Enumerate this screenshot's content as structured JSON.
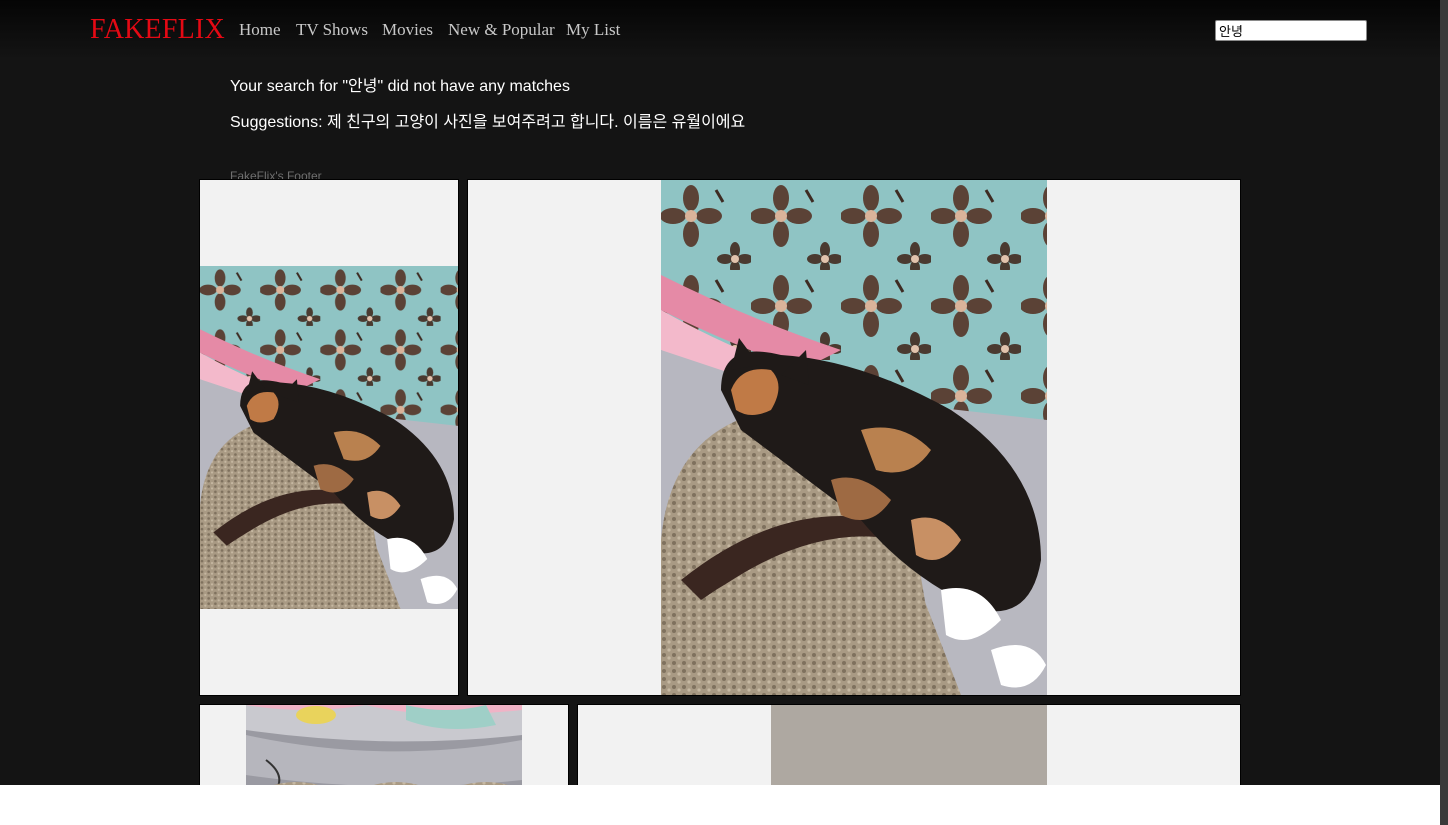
{
  "header": {
    "logo": "FAKEFLIX",
    "nav": [
      {
        "label": "Home"
      },
      {
        "label": "TV Shows"
      },
      {
        "label": "Movies"
      },
      {
        "label": "New & Popular"
      },
      {
        "label": "My List"
      }
    ],
    "search": {
      "value": "안녕"
    }
  },
  "results": {
    "no_match_message": "Your search for \"안녕\" did not have any matches",
    "suggestions": "Suggestions: 제 친구의 고양이 사진을 보여주려고 합니다. 이름은 유월이에요"
  },
  "footer": {
    "text": "FakeFlix's Footer"
  },
  "gallery": {
    "tiles": [
      {
        "photo": "calico-cat-sleeping-on-scratcher"
      },
      {
        "photo": "calico-cat-sleeping-on-scratcher"
      },
      {
        "photo": "cat-bed-with-toys"
      },
      {
        "photo": "grey-wall-photo"
      }
    ]
  },
  "colors": {
    "background": "#141414",
    "brand": "#e50914",
    "nav_text": "#c8c8c8",
    "tile_background": "#f2f2f2"
  }
}
